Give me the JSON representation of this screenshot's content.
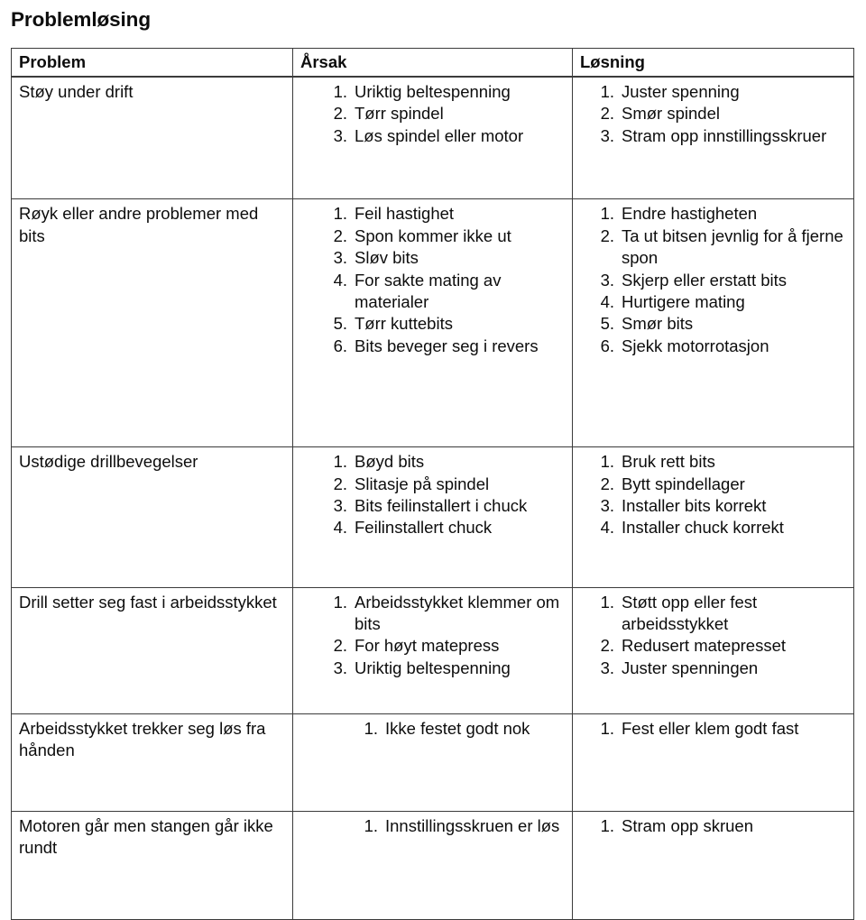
{
  "document": {
    "title": "Problemløsing"
  },
  "table": {
    "headers": {
      "problem": "Problem",
      "cause": "Årsak",
      "solution": "Løsning"
    },
    "rows": [
      {
        "problem": "Støy under drift",
        "causes": [
          "Uriktig beltespenning",
          "Tørr spindel",
          "Løs spindel eller motor"
        ],
        "solutions": [
          "Juster spenning",
          "Smør spindel",
          "Stram opp innstillingsskruer"
        ]
      },
      {
        "problem": "Røyk eller andre problemer med bits",
        "causes": [
          "Feil hastighet",
          "Spon kommer ikke ut",
          "Sløv bits",
          "For sakte mating av materialer",
          "Tørr kuttebits",
          "Bits beveger seg i revers"
        ],
        "solutions": [
          "Endre hastigheten",
          "Ta ut bitsen jevnlig for å fjerne spon",
          "Skjerp eller erstatt bits",
          "Hurtigere mating",
          "Smør bits",
          "Sjekk motorrotasjon"
        ]
      },
      {
        "problem": "Ustødige drillbevegelser",
        "causes": [
          "Bøyd bits",
          "Slitasje på spindel",
          "Bits feilinstallert i chuck",
          "Feilinstallert chuck"
        ],
        "solutions": [
          "Bruk rett bits",
          "Bytt spindellager",
          "Installer bits korrekt",
          "Installer chuck korrekt"
        ]
      },
      {
        "problem": "Drill setter seg fast i arbeidsstykket",
        "causes": [
          "Arbeidsstykket klemmer om bits",
          "For høyt matepress",
          "Uriktig beltespenning"
        ],
        "solutions": [
          "Støtt opp eller fest arbeidsstykket",
          "Redusert matepresset",
          "Juster spenningen"
        ]
      },
      {
        "problem": "Arbeidsstykket trekker seg løs fra hånden",
        "causes": [
          "Ikke festet godt nok"
        ],
        "solutions": [
          "Fest eller klem godt fast"
        ]
      },
      {
        "problem": "Motoren går men stangen går ikke rundt",
        "causes": [
          "Innstillingsskruen er løs"
        ],
        "solutions": [
          "Stram opp skruen"
        ]
      }
    ]
  }
}
